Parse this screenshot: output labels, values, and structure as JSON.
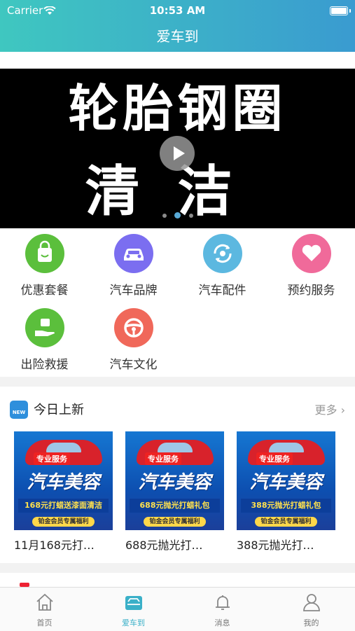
{
  "status": {
    "carrier": "Carrier",
    "time": "10:53 AM"
  },
  "header": {
    "title": "爱车到"
  },
  "banner": {
    "line1": "轮胎钢圈",
    "line2": "清洁",
    "page_count": 3,
    "active_page": 2
  },
  "categories": [
    {
      "label": "优惠套餐",
      "icon": "shopping-bag-icon",
      "color": "#5bbf3c"
    },
    {
      "label": "汽车品牌",
      "icon": "car-icon",
      "color": "#7b6ef0"
    },
    {
      "label": "汽车配件",
      "icon": "parts-cycle-icon",
      "color": "#5cb8e0"
    },
    {
      "label": "预约服务",
      "icon": "heart-icon",
      "color": "#f06a9a"
    },
    {
      "label": "出险救援",
      "icon": "rescue-hand-icon",
      "color": "#5bbf3c"
    },
    {
      "label": "汽车文化",
      "icon": "steering-wheel-icon",
      "color": "#f0685a"
    }
  ],
  "new_today": {
    "title": "今日上新",
    "more": "更多 ›",
    "products": [
      {
        "name": "11月168元打…",
        "tag": "专业服务",
        "headline": "汽车美容",
        "band": "168元打蜡送漆面清洁",
        "footer": "铂金会员专属福利"
      },
      {
        "name": "688元抛光打…",
        "tag": "专业服务",
        "headline": "汽车美容",
        "band": "688元抛光打蜡礼包",
        "footer": "铂金会员专属福利"
      },
      {
        "name": "388元抛光打…",
        "tag": "专业服务",
        "headline": "汽车美容",
        "band": "388元抛光打蜡礼包",
        "footer": "铂金会员专属福利"
      }
    ]
  },
  "tabbar": {
    "items": [
      {
        "label": "首页",
        "icon": "home-icon"
      },
      {
        "label": "爱车到",
        "icon": "car-service-icon",
        "active": true
      },
      {
        "label": "消息",
        "icon": "bell-icon"
      },
      {
        "label": "我的",
        "icon": "user-icon"
      }
    ],
    "accent": "#3ab0c8"
  }
}
